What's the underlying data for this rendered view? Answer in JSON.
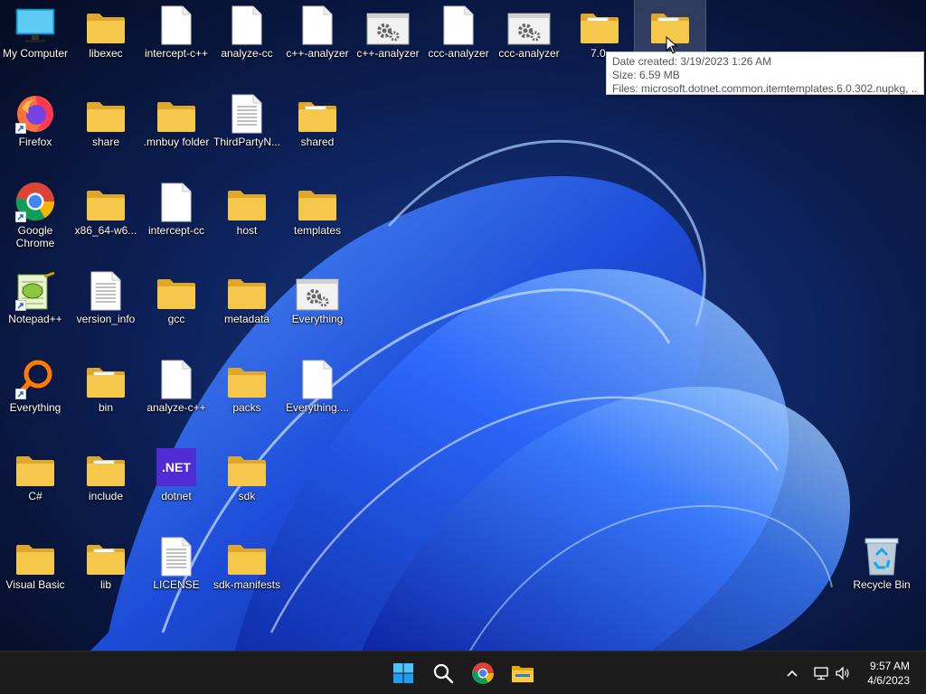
{
  "desktop": {
    "icons": [
      {
        "label": "My Computer",
        "icon": "monitor-icon"
      },
      {
        "label": "libexec",
        "icon": "folder-icon"
      },
      {
        "label": "intercept-c++",
        "icon": "file-icon"
      },
      {
        "label": "analyze-cc",
        "icon": "file-icon"
      },
      {
        "label": "c++-analyzer",
        "icon": "file-icon"
      },
      {
        "label": "c++-analyzer",
        "icon": "settings-file-icon"
      },
      {
        "label": "ccc-analyzer",
        "icon": "file-icon"
      },
      {
        "label": "ccc-analyzer",
        "icon": "settings-file-icon"
      },
      {
        "label": "7.0.",
        "icon": "folder-icon"
      },
      {
        "label": "",
        "icon": "folder-icon"
      },
      {
        "label": "Firefox",
        "icon": "firefox-icon"
      },
      {
        "label": "share",
        "icon": "folder-icon"
      },
      {
        "label": ".mnbuy folder",
        "icon": "folder-icon"
      },
      {
        "label": "ThirdPartyN...",
        "icon": "text-file-icon"
      },
      {
        "label": "shared",
        "icon": "folder-icon"
      },
      {
        "label": "Google Chrome",
        "icon": "chrome-icon"
      },
      {
        "label": "x86_64-w6...",
        "icon": "folder-icon"
      },
      {
        "label": "intercept-cc",
        "icon": "file-icon"
      },
      {
        "label": "host",
        "icon": "folder-icon"
      },
      {
        "label": "templates",
        "icon": "folder-icon"
      },
      {
        "label": "Notepad++",
        "icon": "notepad-plus-plus-icon"
      },
      {
        "label": "version_info",
        "icon": "text-file-icon"
      },
      {
        "label": "gcc",
        "icon": "folder-icon"
      },
      {
        "label": "metadata",
        "icon": "folder-icon"
      },
      {
        "label": "Everything",
        "icon": "settings-file-icon"
      },
      {
        "label": "Everything",
        "icon": "everything-search-icon"
      },
      {
        "label": "bin",
        "icon": "folder-icon"
      },
      {
        "label": "analyze-c++",
        "icon": "file-icon"
      },
      {
        "label": "packs",
        "icon": "folder-icon"
      },
      {
        "label": "Everything....",
        "icon": "file-icon"
      },
      {
        "label": "C#",
        "icon": "folder-icon"
      },
      {
        "label": "include",
        "icon": "folder-icon"
      },
      {
        "label": "dotnet",
        "icon": "dotnet-icon"
      },
      {
        "label": "sdk",
        "icon": "folder-icon"
      },
      {
        "label": "Visual Basic",
        "icon": "folder-icon"
      },
      {
        "label": "lib",
        "icon": "folder-icon"
      },
      {
        "label": "LICENSE",
        "icon": "text-file-icon"
      },
      {
        "label": "sdk-manifests",
        "icon": "folder-icon"
      },
      {
        "label": "Recycle Bin",
        "icon": "recycle-bin-icon"
      }
    ]
  },
  "dotnet_label": ".NET",
  "tooltip": {
    "date_created": "Date created: 3/19/2023 1:26 AM",
    "size": "Size: 6.59 MB",
    "files": "Files: microsoft.dotnet.common.itemtemplates.6.0.302.nupkg, ..."
  },
  "taskbar": {
    "buttons": [
      {
        "name": "start",
        "icon": "windows-start-icon"
      },
      {
        "name": "search",
        "icon": "search-icon"
      },
      {
        "name": "chrome",
        "icon": "chrome-icon"
      },
      {
        "name": "file-explorer",
        "icon": "file-explorer-icon"
      }
    ],
    "tray": [
      "chevron-up-icon",
      "network-icon",
      "volume-icon"
    ],
    "time": "9:57 AM",
    "date": "4/6/2023"
  },
  "colors": {
    "folder": "#f5c84c",
    "taskbar": "#1c1c1c",
    "accent": "#0078d4"
  }
}
